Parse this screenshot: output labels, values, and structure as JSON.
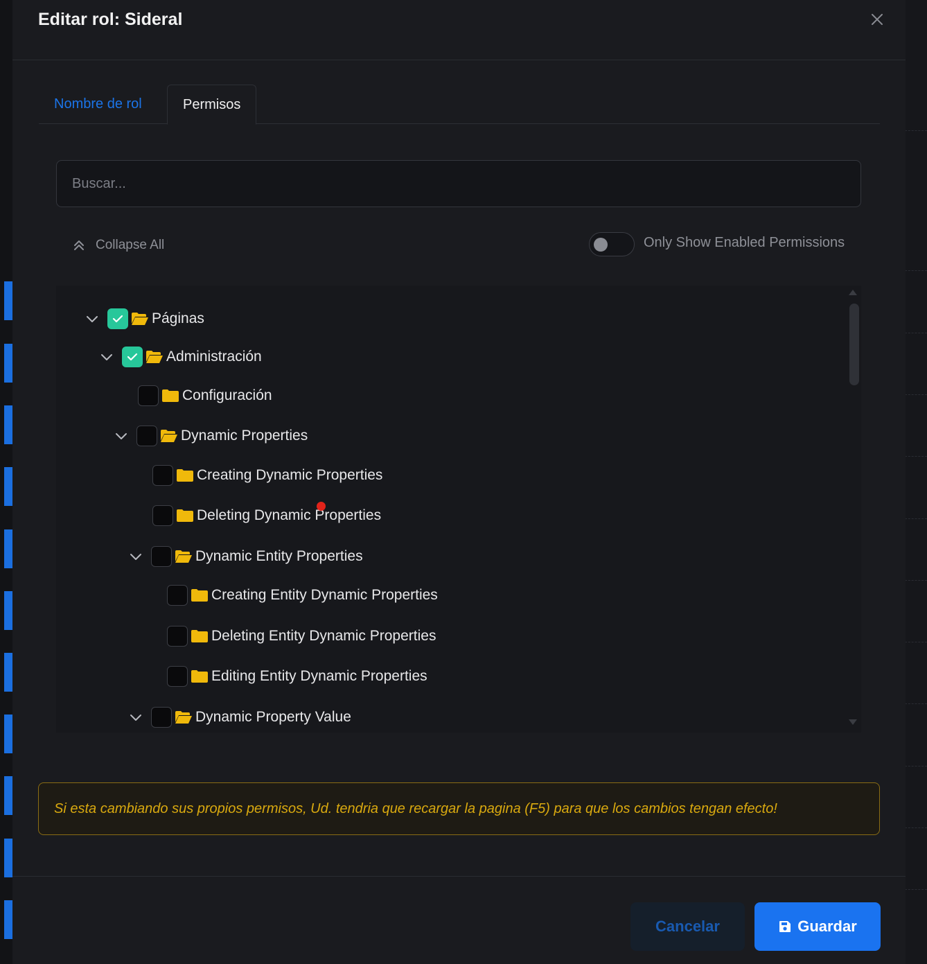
{
  "modal": {
    "title": "Editar rol: Sideral"
  },
  "tabs": [
    {
      "label": "Nombre de rol",
      "active": false
    },
    {
      "label": "Permisos",
      "active": true
    }
  ],
  "search": {
    "placeholder": "Buscar...",
    "value": ""
  },
  "controls": {
    "collapse_all_label": "Collapse All",
    "toggle_label": "Only Show Enabled Permissions",
    "toggle_on": false
  },
  "tree": [
    {
      "label": "Páginas",
      "checked": true,
      "expandable": true,
      "expanded": true,
      "level": 0
    },
    {
      "label": "Administración",
      "checked": true,
      "expandable": true,
      "expanded": true,
      "level": 1
    },
    {
      "label": "Configuración",
      "checked": false,
      "expandable": false,
      "level": 2
    },
    {
      "label": "Dynamic Properties",
      "checked": false,
      "expandable": true,
      "expanded": true,
      "level": 2
    },
    {
      "label": "Creating Dynamic Properties",
      "checked": false,
      "expandable": false,
      "level": 3
    },
    {
      "label": "Deleting Dynamic Properties",
      "checked": false,
      "expandable": false,
      "level": 3
    },
    {
      "label": "Dynamic Entity Properties",
      "checked": false,
      "expandable": true,
      "expanded": true,
      "level": 3
    },
    {
      "label": "Creating Entity Dynamic Properties",
      "checked": false,
      "expandable": false,
      "level": 4
    },
    {
      "label": "Deleting Entity Dynamic Properties",
      "checked": false,
      "expandable": false,
      "level": 4
    },
    {
      "label": "Editing Entity Dynamic Properties",
      "checked": false,
      "expandable": false,
      "level": 4
    },
    {
      "label": "Dynamic Property Value",
      "checked": false,
      "expandable": true,
      "expanded": true,
      "level": 3
    }
  ],
  "alert": {
    "text": "Si esta cambiando sus propios permisos, Ud. tendria que recargar la pagina (F5) para que los cambios tengan efecto!"
  },
  "footer": {
    "cancel_label": "Cancelar",
    "save_label": "Guardar"
  },
  "colors": {
    "accent": "#1a73f0",
    "checkbox_checked": "#27c79a",
    "folder": "#f0b90b",
    "warning": "#d9a90f"
  }
}
